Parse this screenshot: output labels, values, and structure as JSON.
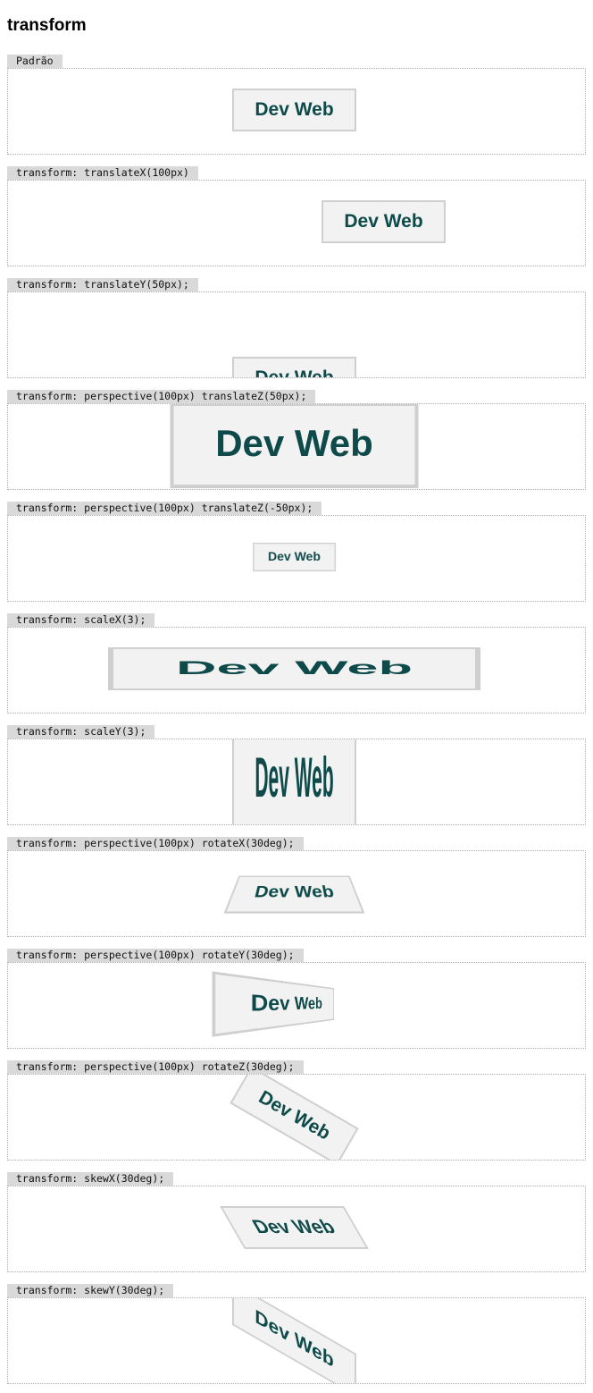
{
  "page": {
    "title": "transform"
  },
  "demo_text": "Dev Web",
  "sections": [
    {
      "label": "Padrão"
    },
    {
      "label": "transform: translateX(100px)"
    },
    {
      "label": "transform: translateY(50px);"
    },
    {
      "label": "transform: perspective(100px) translateZ(50px);"
    },
    {
      "label": "transform: perspective(100px) translateZ(-50px);"
    },
    {
      "label": "transform: scaleX(3);"
    },
    {
      "label": "transform: scaleY(3);"
    },
    {
      "label": "transform: perspective(100px) rotateX(30deg);"
    },
    {
      "label": "transform: perspective(100px) rotateY(30deg);"
    },
    {
      "label": "transform: perspective(100px) rotateZ(30deg);"
    },
    {
      "label": "transform: skewX(30deg);"
    },
    {
      "label": "transform: skewY(30deg);"
    }
  ],
  "colors": {
    "text_accent": "#0e4a49",
    "box_fill": "#f2f2f2",
    "box_border": "#cfcfcf",
    "label_background": "#d9d9d9"
  }
}
